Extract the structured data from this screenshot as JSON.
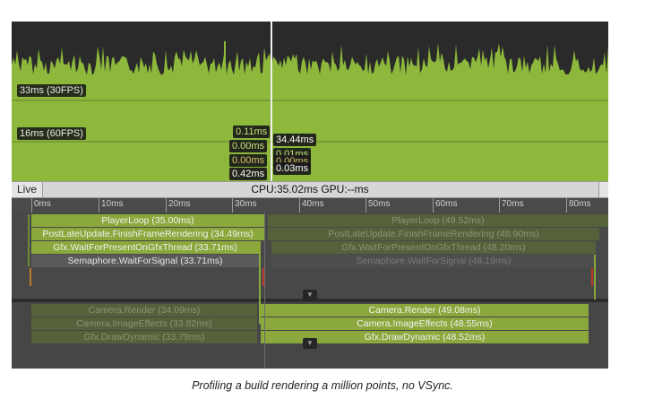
{
  "chart": {
    "fps_labels": {
      "label_33": "33ms (30FPS)",
      "label_16": "16ms (60FPS)"
    },
    "left_frame_values": [
      "0.11ms",
      "0.00ms",
      "0.00ms",
      "0.42ms"
    ],
    "right_frame_values": [
      "34.44ms",
      "0.01ms",
      "0.00ms",
      "0.03ms"
    ],
    "colors": {
      "cpu_green": "#8db83b",
      "value_green": "#c7e07a",
      "value_yellow": "#d9c26a",
      "value_white": "#ffffff"
    }
  },
  "status": {
    "live_label": "Live",
    "cpu_gpu": "CPU:35.02ms  GPU:--ms"
  },
  "ruler": {
    "ticks": [
      "0ms",
      "10ms",
      "20ms",
      "30ms",
      "40ms",
      "50ms",
      "60ms",
      "70ms",
      "80ms"
    ]
  },
  "timeline": {
    "main_thread": {
      "left": [
        "PlayerLoop (35.00ms)",
        "PostLateUpdate.FinishFrameRendering (34.49ms)",
        "Gfx.WaitForPresentOnGfxThread (33.71ms)",
        "Semaphore.WaitForSignal (33.71ms)"
      ],
      "right": [
        "PlayerLoop (49.52ms)",
        "PostLateUpdate.FinishFrameRendering (48.90ms)",
        "Gfx.WaitForPresentOnGfxThread (48.20ms)",
        "Semaphore.WaitForSignal (48.19ms)"
      ]
    },
    "render_thread": {
      "left": [
        "Camera.Render (34.09ms)",
        "Camera.ImageEffects (33.82ms)",
        "Gfx.DrawDynamic (33.79ms)"
      ],
      "right": [
        "Camera.Render (49.08ms)",
        "Camera.ImageEffects (48.55ms)",
        "Gfx.DrawDynamic (48.52ms)"
      ]
    }
  },
  "caption": "Profiling a build rendering a million points, no VSync."
}
